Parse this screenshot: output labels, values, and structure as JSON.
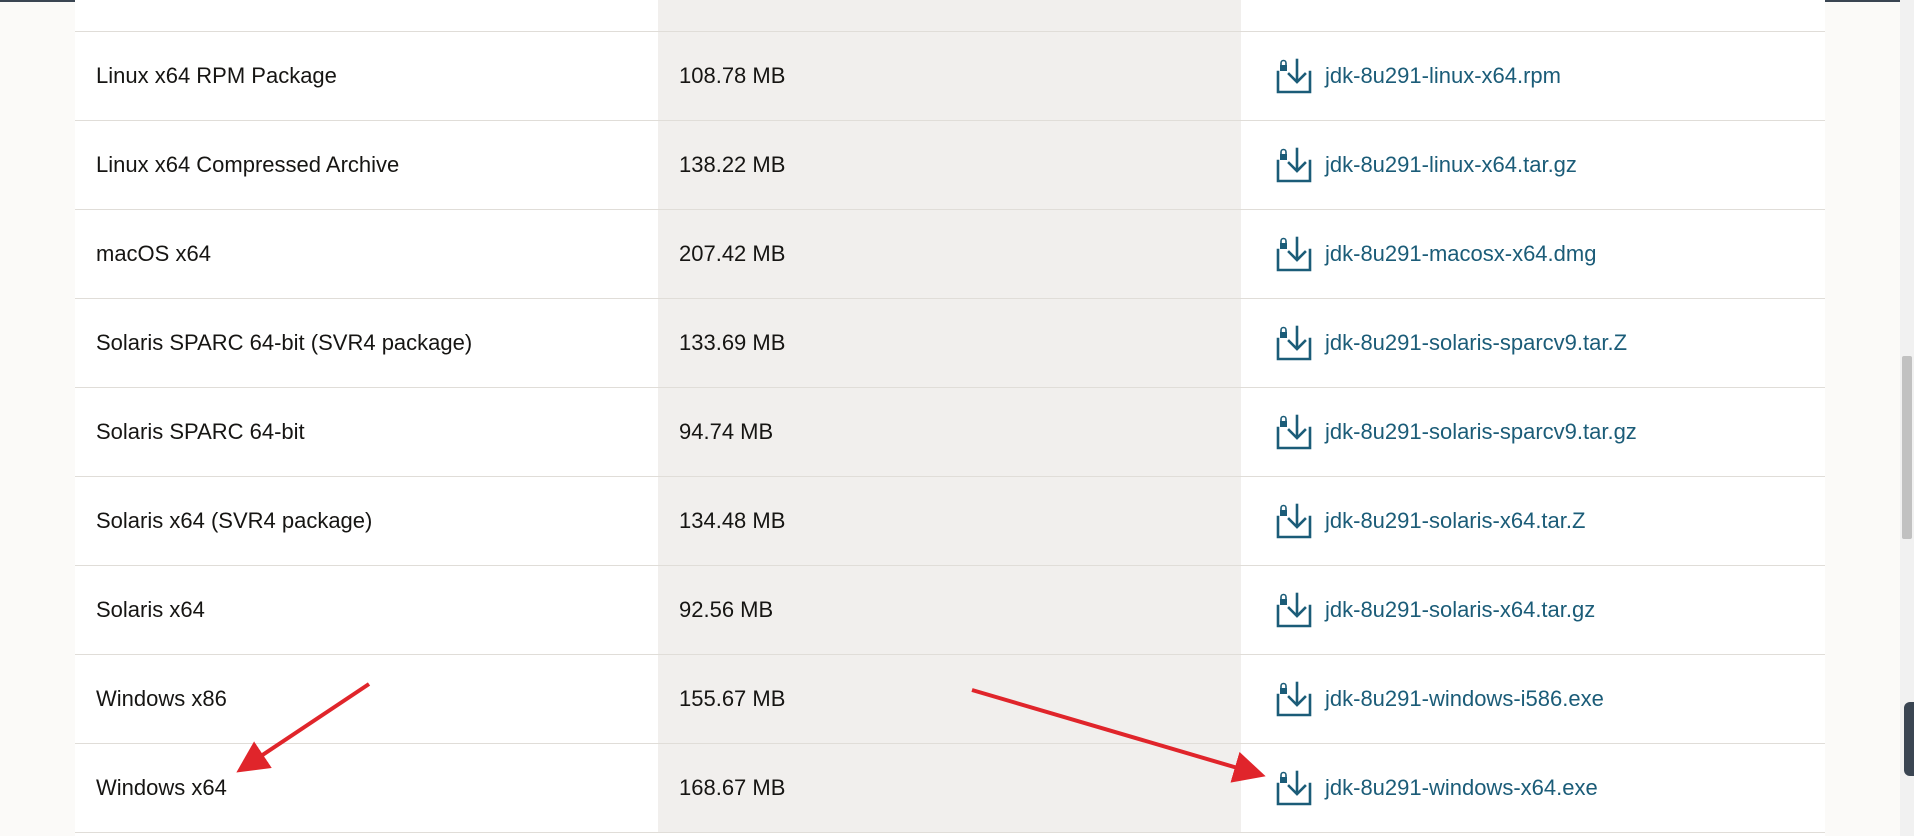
{
  "downloads": {
    "rows": [
      {
        "product": "Linux x64 RPM Package",
        "size": "108.78 MB",
        "file": "jdk-8u291-linux-x64.rpm"
      },
      {
        "product": "Linux x64 Compressed Archive",
        "size": "138.22 MB",
        "file": "jdk-8u291-linux-x64.tar.gz"
      },
      {
        "product": "macOS x64",
        "size": "207.42 MB",
        "file": "jdk-8u291-macosx-x64.dmg"
      },
      {
        "product": "Solaris SPARC 64-bit (SVR4 package)",
        "size": "133.69 MB",
        "file": "jdk-8u291-solaris-sparcv9.tar.Z"
      },
      {
        "product": "Solaris SPARC 64-bit",
        "size": "94.74 MB",
        "file": "jdk-8u291-solaris-sparcv9.tar.gz"
      },
      {
        "product": "Solaris x64 (SVR4 package)",
        "size": "134.48 MB",
        "file": "jdk-8u291-solaris-x64.tar.Z"
      },
      {
        "product": "Solaris x64",
        "size": "92.56 MB",
        "file": "jdk-8u291-solaris-x64.tar.gz"
      },
      {
        "product": "Windows x86",
        "size": "155.67 MB",
        "file": "jdk-8u291-windows-i586.exe"
      },
      {
        "product": "Windows x64",
        "size": "168.67 MB",
        "file": "jdk-8u291-windows-x64.exe"
      }
    ]
  },
  "colors": {
    "link": "#1b5c78",
    "annotation_arrow": "#e0252b",
    "size_column_bg": "#f1efed"
  },
  "icons": {
    "download": "download-icon"
  }
}
